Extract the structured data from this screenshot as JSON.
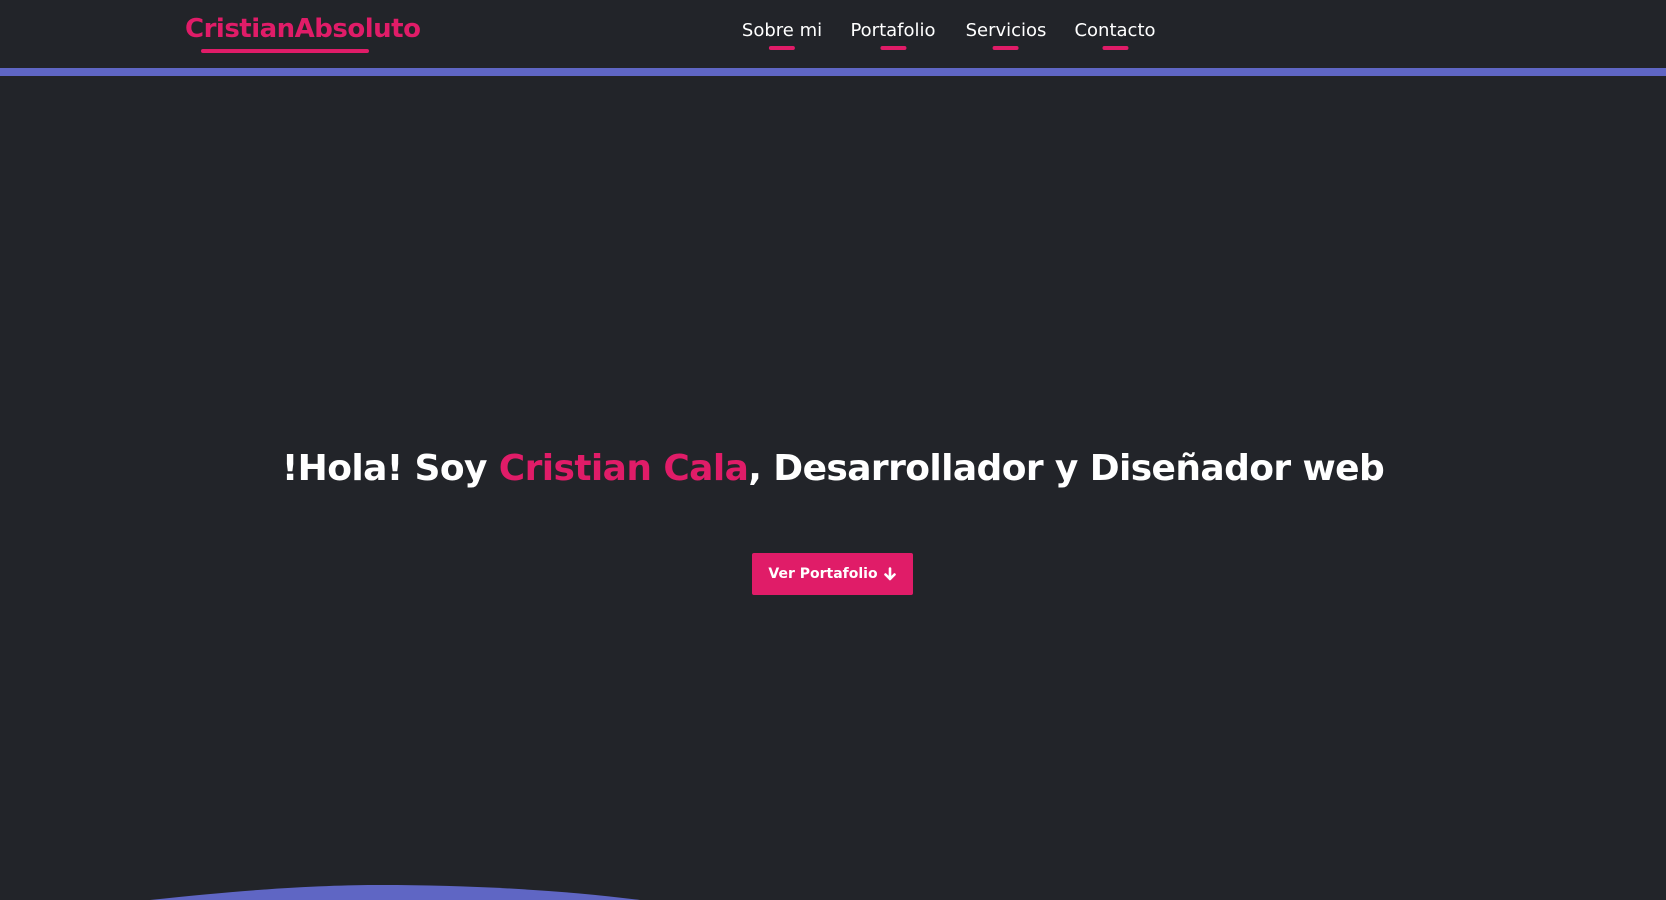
{
  "header": {
    "brand": "CristianAbsoluto",
    "nav": [
      {
        "label": "Sobre mi"
      },
      {
        "label": "Portafolio"
      },
      {
        "label": "Servicios"
      },
      {
        "label": "Contacto"
      }
    ]
  },
  "hero": {
    "title_prefix": "!Hola! Soy ",
    "title_highlight": "Cristian Cala",
    "title_suffix": ", Desarrollador y Diseñador web",
    "cta_label": "Ver Portafolio",
    "cta_icon": "arrow-down-icon"
  },
  "colors": {
    "background": "#222429",
    "accent": "#e01c68",
    "secondary": "#5f66c4",
    "text": "#ffffff"
  }
}
